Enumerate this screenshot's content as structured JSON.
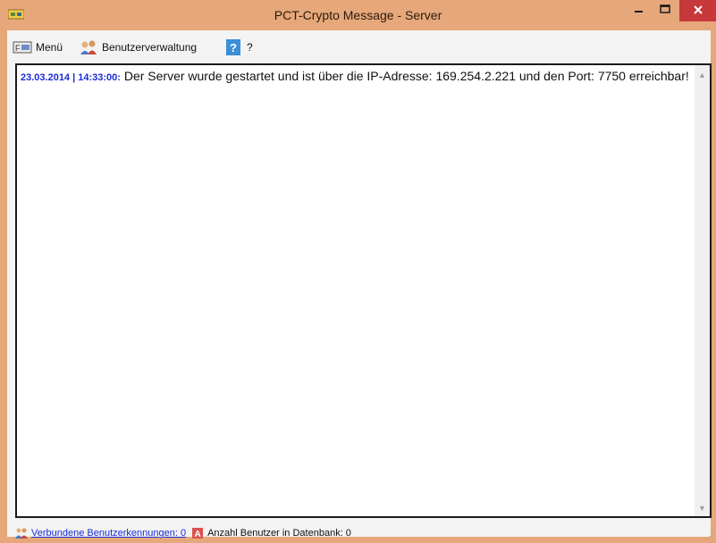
{
  "window": {
    "title": "PCT-Crypto Message - Server",
    "minimize_glyph": "–",
    "maximize_glyph": "□",
    "close_glyph": "✕"
  },
  "menubar": {
    "items": [
      {
        "label": "Menü",
        "icon": "file-menu-icon"
      },
      {
        "label": "Benutzerverwaltung",
        "icon": "users-icon"
      },
      {
        "label": "?",
        "icon": "help-icon"
      }
    ]
  },
  "log": {
    "entries": [
      {
        "timestamp": "23.03.2014 | 14:33:00:",
        "message": " Der Server wurde gestartet und ist über die IP-Adresse: 169.254.2.221 und den Port: 7750 erreichbar!"
      }
    ]
  },
  "statusbar": {
    "connected_link": "Verbundene Benutzerkennungen: 0",
    "db_users": "Anzahl Benutzer in Datenbank: 0"
  },
  "colors": {
    "title_bg": "#e6a87a",
    "close_red": "#c7383a",
    "timestamp_blue": "#1a2bd6"
  }
}
